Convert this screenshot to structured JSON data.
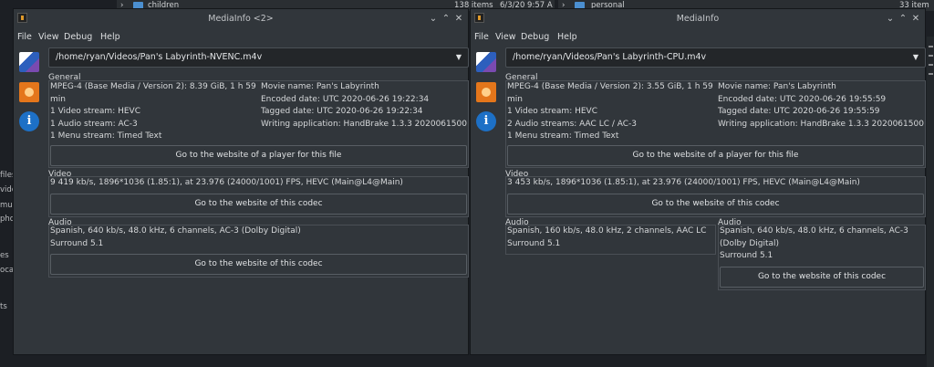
{
  "background": {
    "left_row": {
      "folder_name": "children",
      "items": "138 items",
      "date": "6/3/20 9:57 A"
    },
    "right_row": {
      "folder_name": "personal",
      "items": "33 item"
    },
    "sidebar_fragments": [
      "files",
      "vide",
      "mu:",
      "pho",
      "es",
      "oca",
      "ts"
    ]
  },
  "windows": [
    {
      "title": "MediaInfo <2>",
      "menu": [
        "File",
        "View",
        "Debug",
        "Help"
      ],
      "file_path": "/home/ryan/Videos/Pan's Labyrinth-NVENC.m4v",
      "general": {
        "label": "General",
        "left_lines": [
          "MPEG-4 (Base Media / Version 2): 8.39 GiB, 1 h 59",
          "min",
          "1 Video stream: HEVC",
          "1 Audio stream: AC-3",
          "1 Menu stream: Timed Text"
        ],
        "right_lines": [
          "Movie name: Pan's Labyrinth",
          "Encoded date: UTC 2020-06-26 19:22:34",
          "Tagged date: UTC 2020-06-26 19:22:34",
          "Writing application: HandBrake 1.3.3 2020061500"
        ],
        "button": "Go to the website of a player for this file"
      },
      "video": {
        "label": "Video",
        "line": "9 419 kb/s, 1896*1036 (1.85:1), at 23.976 (24000/1001) FPS, HEVC (Main@L4@Main)",
        "button": "Go to the website of this codec"
      },
      "audio": [
        {
          "label": "Audio",
          "lines": [
            "Spanish, 640 kb/s, 48.0 kHz, 6 channels, AC-3 (Dolby Digital)",
            "Surround 5.1"
          ],
          "button": "Go to the website of this codec"
        }
      ]
    },
    {
      "title": "MediaInfo",
      "menu": [
        "File",
        "View",
        "Debug",
        "Help"
      ],
      "file_path": "/home/ryan/Videos/Pan's Labyrinth-CPU.m4v",
      "general": {
        "label": "General",
        "left_lines": [
          "MPEG-4 (Base Media / Version 2): 3.55 GiB, 1 h 59",
          "min",
          "1 Video stream: HEVC",
          "2 Audio streams: AAC LC / AC-3",
          "1 Menu stream: Timed Text"
        ],
        "right_lines": [
          "Movie name: Pan's Labyrinth",
          "Encoded date: UTC 2020-06-26 19:55:59",
          "Tagged date: UTC 2020-06-26 19:55:59",
          "Writing application: HandBrake 1.3.3 2020061500"
        ],
        "button": "Go to the website of a player for this file"
      },
      "video": {
        "label": "Video",
        "line": "3 453 kb/s, 1896*1036 (1.85:1), at 23.976 (24000/1001) FPS, HEVC (Main@L4@Main)",
        "button": "Go to the website of this codec"
      },
      "audio": [
        {
          "label": "Audio",
          "lines": [
            "Spanish, 160 kb/s, 48.0 kHz, 2 channels, AAC LC",
            "Surround 5.1"
          ]
        },
        {
          "label": "Audio",
          "lines": [
            "Spanish, 640 kb/s, 48.0 kHz, 6 channels, AC-3",
            "(Dolby Digital)",
            "Surround 5.1"
          ],
          "button": "Go to the website of this codec"
        }
      ]
    }
  ]
}
